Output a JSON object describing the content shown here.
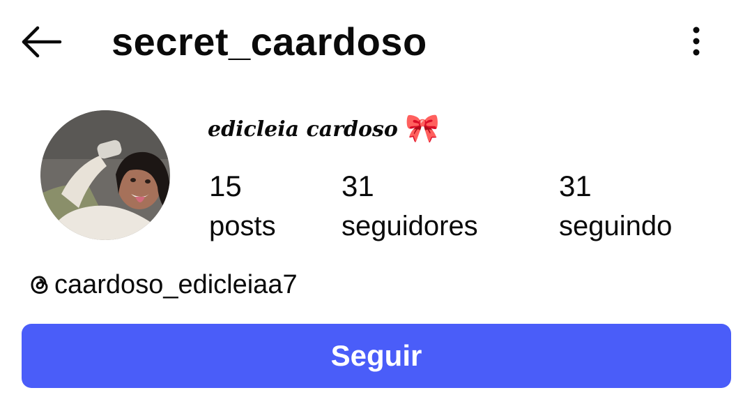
{
  "header": {
    "username": "secret_caardoso",
    "back_icon": "arrow-left-icon",
    "more_icon": "more-vertical-icon"
  },
  "profile": {
    "display_name": "edicleia cardoso",
    "display_name_emoji": "🎀",
    "avatar_icon": "profile-photo",
    "stats": {
      "posts": {
        "count": "15",
        "label": "posts"
      },
      "followers": {
        "count": "31",
        "label": "seguidores"
      },
      "following": {
        "count": "31",
        "label": "seguindo"
      }
    },
    "threads": {
      "icon": "threads-icon",
      "handle": "caardoso_edicleiaa7"
    }
  },
  "actions": {
    "follow_label": "Seguir"
  },
  "colors": {
    "follow_button": "#4a5df9",
    "follow_text": "#ffffff",
    "text": "#0a0a0a",
    "background": "#ffffff"
  }
}
